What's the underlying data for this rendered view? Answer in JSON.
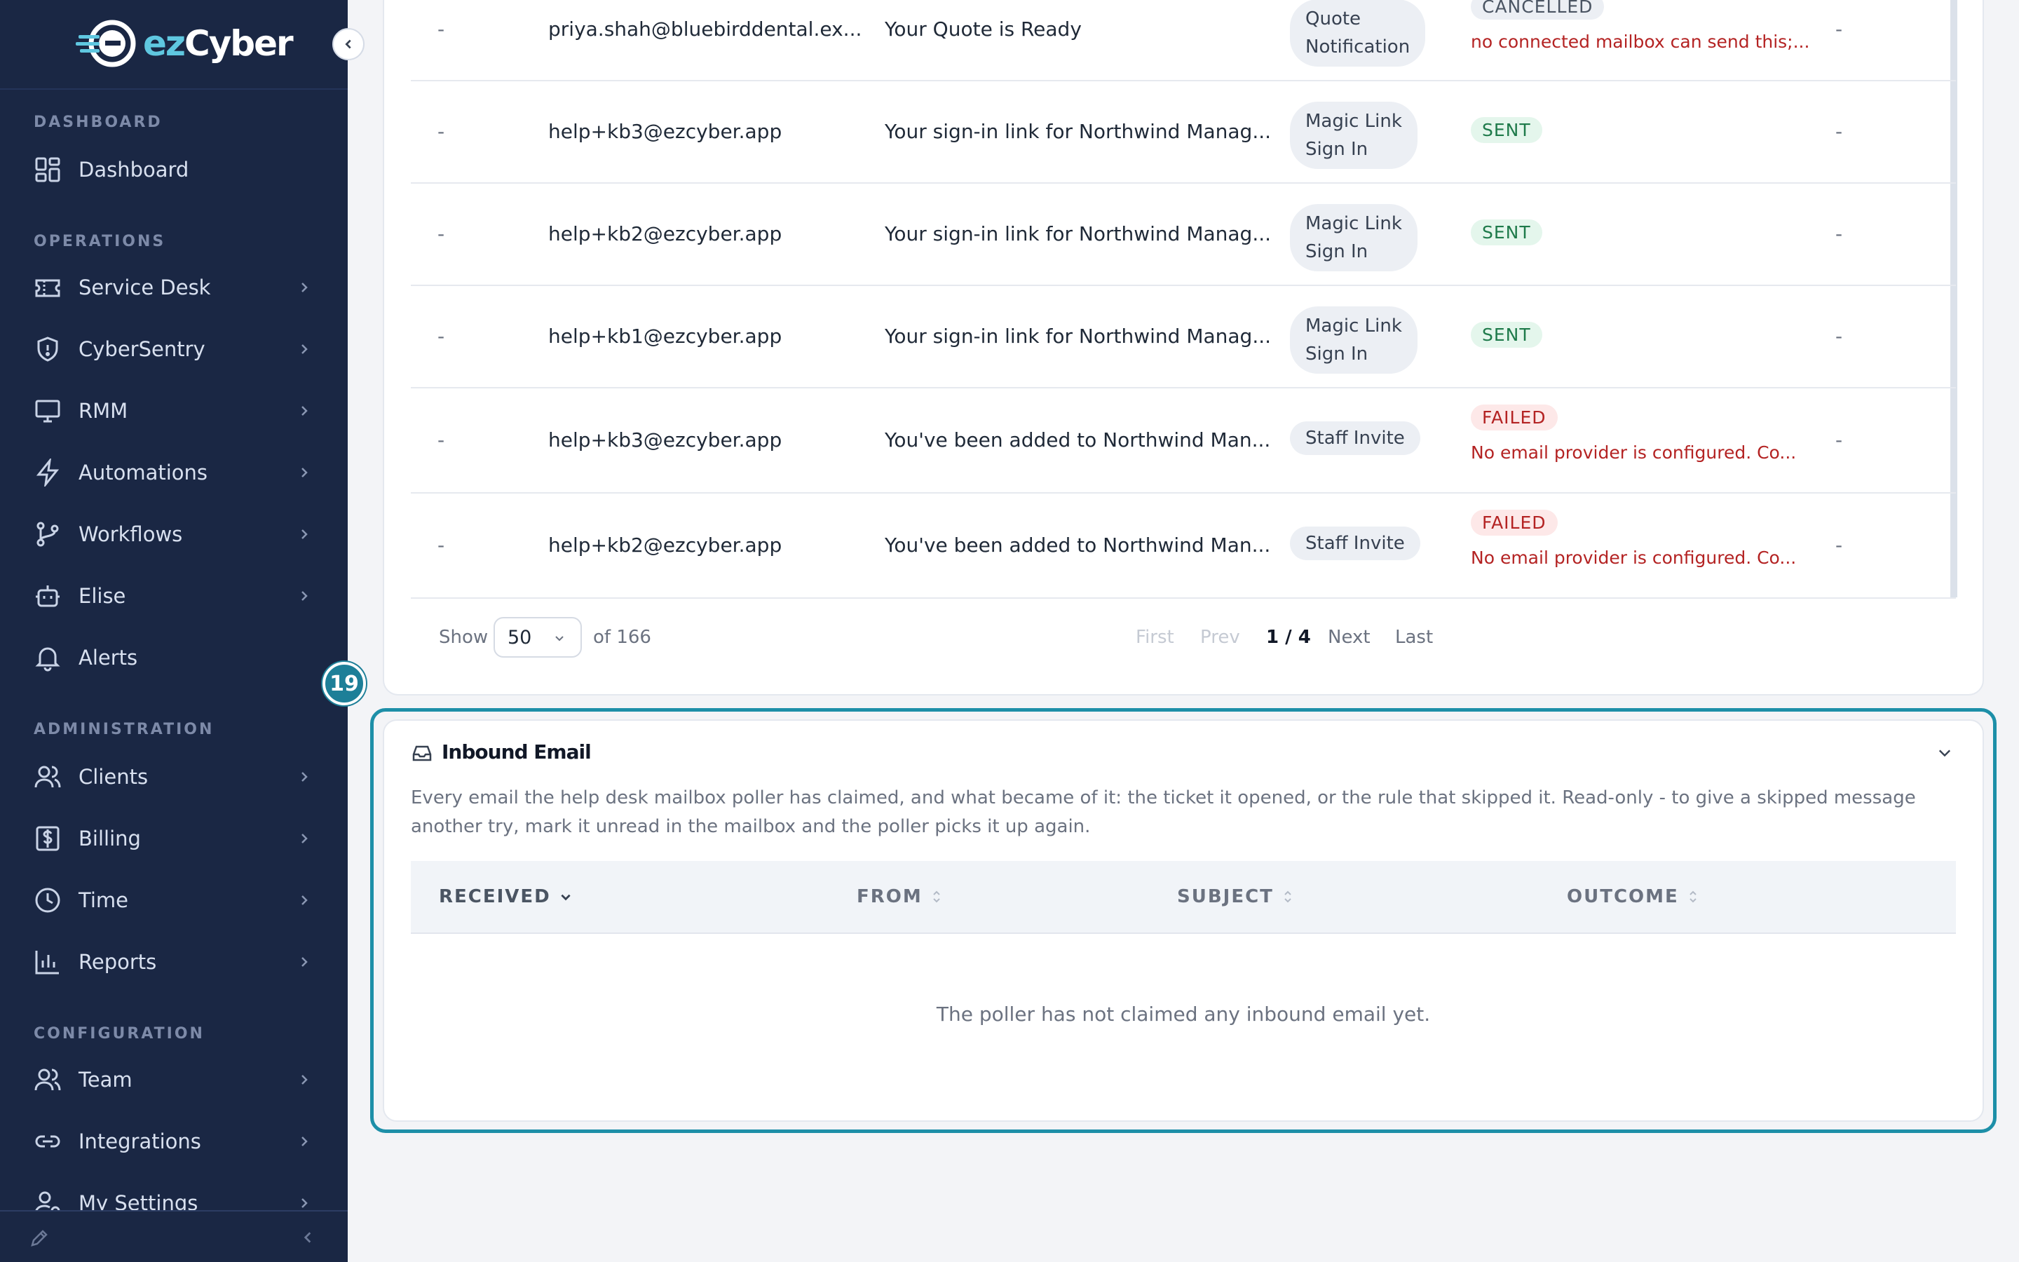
{
  "app": {
    "brand_prefix": "ez",
    "brand_suffix": "Cyber"
  },
  "sidebar": {
    "sections": {
      "dashboard": "DASHBOARD",
      "operations": "OPERATIONS",
      "administration": "ADMINISTRATION",
      "configuration": "CONFIGURATION"
    },
    "items": {
      "dashboard": "Dashboard",
      "service_desk": "Service Desk",
      "cybersentry": "CyberSentry",
      "rmm": "RMM",
      "automations": "Automations",
      "workflows": "Workflows",
      "elise": "Elise",
      "alerts": "Alerts",
      "clients": "Clients",
      "billing": "Billing",
      "time": "Time",
      "reports": "Reports",
      "team": "Team",
      "integrations": "Integrations",
      "my_settings": "My Settings"
    }
  },
  "outbound": {
    "rows": [
      {
        "col1": "-",
        "to": "priya.shah@bluebirddental.ex...",
        "subject": "Your Quote is Ready",
        "type_line1": "Quote",
        "type_line2": "Notification",
        "status": "CANCELLED",
        "error": "no connected mailbox can send this;...",
        "last": "-"
      },
      {
        "col1": "-",
        "to": "help+kb3@ezcyber.app",
        "subject": "Your sign-in link for Northwind Manag...",
        "type_line1": "Magic Link",
        "type_line2": "Sign In",
        "status": "SENT",
        "error": "",
        "last": "-"
      },
      {
        "col1": "-",
        "to": "help+kb2@ezcyber.app",
        "subject": "Your sign-in link for Northwind Manag...",
        "type_line1": "Magic Link",
        "type_line2": "Sign In",
        "status": "SENT",
        "error": "",
        "last": "-"
      },
      {
        "col1": "-",
        "to": "help+kb1@ezcyber.app",
        "subject": "Your sign-in link for Northwind Manag...",
        "type_line1": "Magic Link",
        "type_line2": "Sign In",
        "status": "SENT",
        "error": "",
        "last": "-"
      },
      {
        "col1": "-",
        "to": "help+kb3@ezcyber.app",
        "subject": "You've been added to Northwind Man...",
        "type_line1": "Staff Invite",
        "type_line2": "",
        "status": "FAILED",
        "error": "No email provider is configured. Co...",
        "last": "-"
      },
      {
        "col1": "-",
        "to": "help+kb2@ezcyber.app",
        "subject": "You've been added to Northwind Man...",
        "type_line1": "Staff Invite",
        "type_line2": "",
        "status": "FAILED",
        "error": "No email provider is configured. Co...",
        "last": "-"
      }
    ],
    "pager": {
      "show_label": "Show",
      "page_size": "50",
      "of_total": "of 166",
      "first": "First",
      "prev": "Prev",
      "current": "1 / 4",
      "next": "Next",
      "last": "Last"
    }
  },
  "badge": "19",
  "inbound": {
    "title": "Inbound Email",
    "description": "Every email the help desk mailbox poller has claimed, and what became of it: the ticket it opened, or the rule that skipped it. Read-only - to give a skipped message another try, mark it unread in the mailbox and the poller picks it up again.",
    "columns": {
      "received": "RECEIVED",
      "from": "FROM",
      "subject": "SUBJECT",
      "outcome": "OUTCOME"
    },
    "empty": "The poller has not claimed any inbound email yet."
  },
  "colors": {
    "sidebar_bg": "#1a2744",
    "accent": "#1d8fa8",
    "sent": "#1e7a4a",
    "failed": "#b42323"
  }
}
